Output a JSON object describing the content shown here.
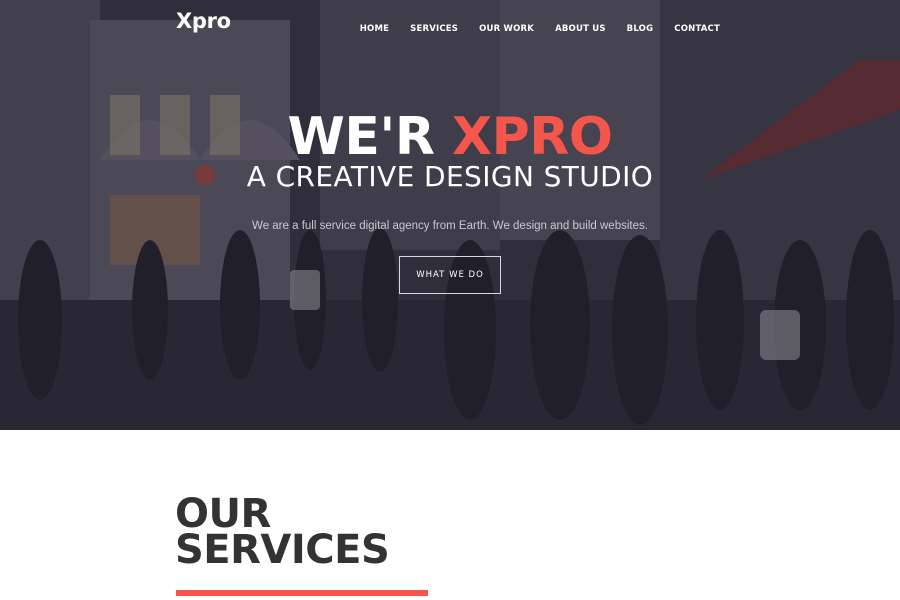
{
  "brand": {
    "logo": "Xpro"
  },
  "nav": {
    "items": [
      {
        "label": "HOME"
      },
      {
        "label": "SERVICES"
      },
      {
        "label": "OUR WORK"
      },
      {
        "label": "ABOUT US"
      },
      {
        "label": "BLOG"
      },
      {
        "label": "CONTACT"
      }
    ]
  },
  "hero": {
    "title_prefix": "WE'R",
    "title_accent": "XPRO",
    "subtitle": "A CREATIVE DESIGN STUDIO",
    "description": "We are a full service digital agency from Earth. We design and build websites.",
    "cta_label": "WHAT WE DO"
  },
  "services": {
    "heading_line1": "OUR",
    "heading_line2": "SERVICES"
  },
  "colors": {
    "accent": "#f5564b",
    "heading_text": "#333333",
    "overlay": "#262434"
  }
}
